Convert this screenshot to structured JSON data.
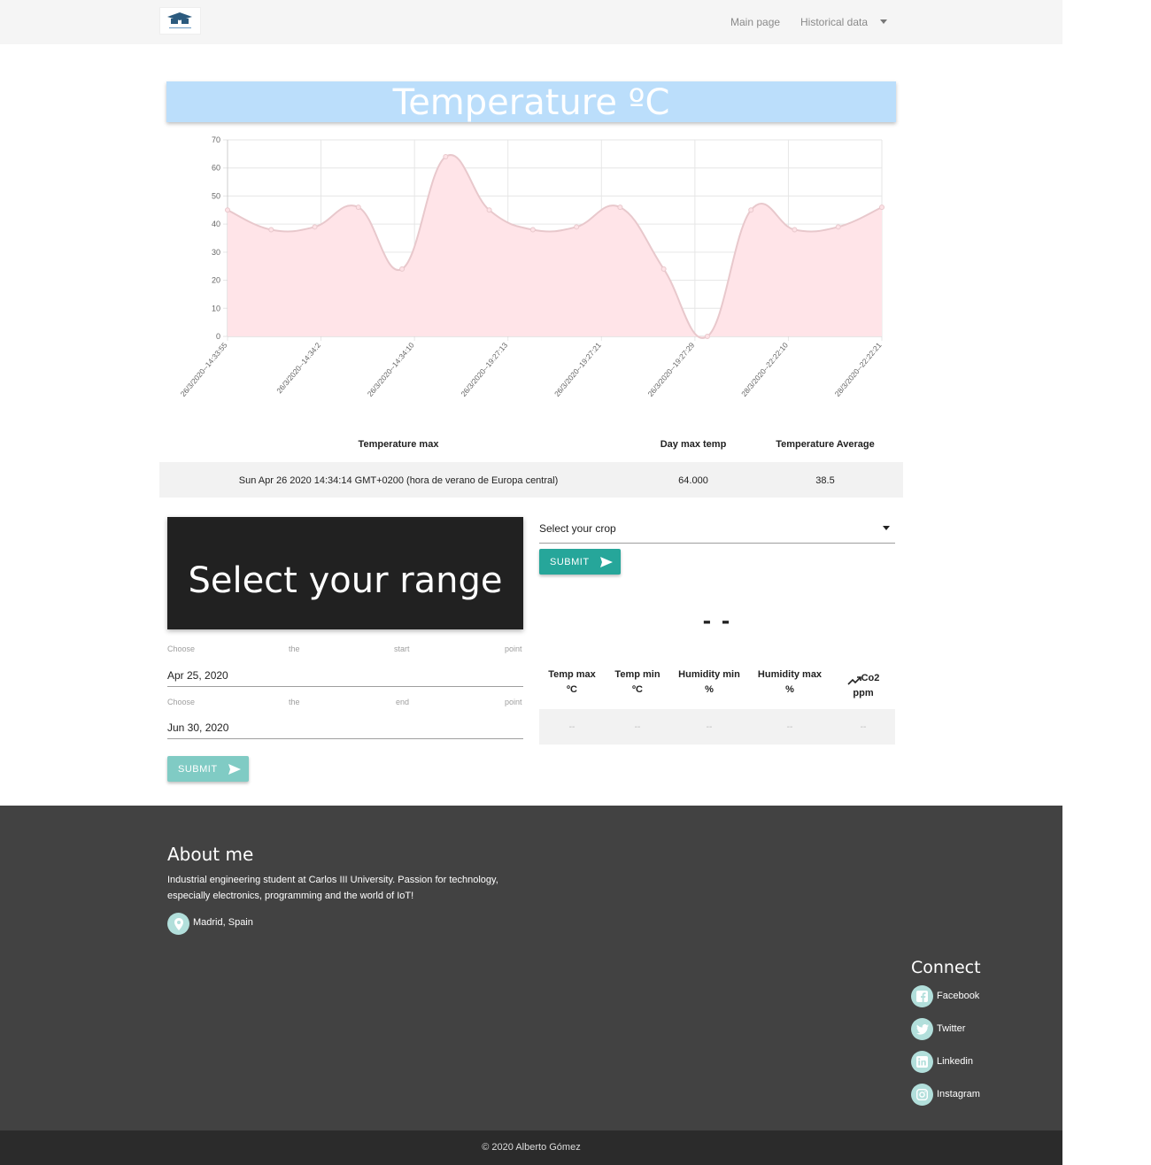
{
  "nav": {
    "main_page": "Main page",
    "historical_data": "Historical data"
  },
  "chart_title": "Temperature ºC",
  "chart_data": {
    "type": "area",
    "title": "Temperature ºC",
    "x": [
      "26/3/2020--14:33:55",
      "",
      "26/3/2020--14:34:2",
      "",
      "26/3/2020--14:34:10",
      "",
      "26/3/2020--19:27:13",
      "",
      "26/3/2020--19:27:21",
      "",
      "26/3/2020--19:27:29",
      "",
      "28/3/2020--22:22:10",
      "",
      "28/3/2020--22:22:21"
    ],
    "tick_labels": [
      "26/3/2020--14:33:55",
      "26/3/2020--14:34:2",
      "26/3/2020--14:34:10",
      "26/3/2020--19:27:13",
      "26/3/2020--19:27:21",
      "26/3/2020--19:27:29",
      "28/3/2020--22:22:10",
      "28/3/2020--22:22:21"
    ],
    "values": [
      45,
      38,
      39,
      46,
      24,
      64,
      45,
      38,
      39,
      46,
      24,
      0,
      45,
      38,
      39,
      46
    ],
    "ylim": [
      0,
      70
    ],
    "yticks": [
      0,
      10,
      20,
      30,
      40,
      50,
      60,
      70
    ],
    "grid": true,
    "fill_color": "#ffe4e8",
    "line_color": "#e8c8cc"
  },
  "stats": {
    "headers": [
      "Temperature max",
      "Day max temp",
      "Temperature Average"
    ],
    "row": [
      "Sun Apr 26 2020 14:34:14 GMT+0200 (hora de verano de Europa central)",
      "64.000",
      "38.5"
    ]
  },
  "range": {
    "title": "Select your range",
    "start_hint": [
      "Choose",
      "the",
      "start",
      "point"
    ],
    "end_hint": [
      "Choose",
      "the",
      "end",
      "point"
    ],
    "start_date": "Apr 25, 2020",
    "end_date": "Jun 30, 2020",
    "submit_label": "SUBMIT"
  },
  "crop": {
    "select_label": "Select your crop",
    "submit_label": "SUBMIT",
    "big_value": "- -",
    "headers": [
      [
        "Temp max",
        "ºC"
      ],
      [
        "Temp min",
        "ºC"
      ],
      [
        "Humidity min",
        "%"
      ],
      [
        "Humidity max",
        "%"
      ],
      [
        "Co2",
        "ppm"
      ]
    ],
    "row": [
      "--",
      "--",
      "--",
      "--",
      "--"
    ]
  },
  "footer": {
    "about_title": "About me",
    "about_text": "Industrial engineering student at Carlos III University. Passion for technology, especially electronics, programming and the world of IoT!",
    "location": "Madrid, Spain",
    "connect_title": "Connect",
    "social": [
      "Facebook",
      "Twitter",
      "Linkedin",
      "Instagram"
    ],
    "copyright": "© 2020 Alberto Gómez"
  },
  "colors": {
    "accent": "#26a69a",
    "accent_light": "#80cbc4",
    "banner": "#bbdefb",
    "footer": "#424242"
  }
}
